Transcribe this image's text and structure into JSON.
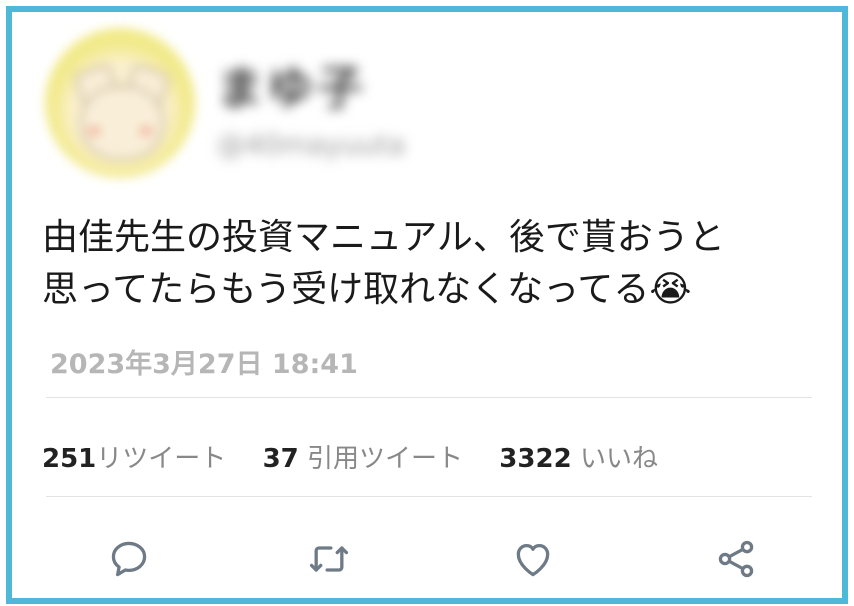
{
  "tweet": {
    "name": "まゆ子",
    "handle": "@40mayuuta",
    "text_line1": "由佳先生の投資マニュアル、後で貰おうと",
    "text_line2": "思ってたらもう受け取れなくなってる😭",
    "timestamp": "2023年3月27日 18:41"
  },
  "stats": {
    "retweets_count": "251",
    "retweets_label": "リツイート",
    "quotes_count": "37",
    "quotes_label": "引用ツイート",
    "likes_count": "3322",
    "likes_label": "いいね"
  },
  "actions": [
    {
      "name": "reply",
      "icon": "comment-icon"
    },
    {
      "name": "retweet",
      "icon": "retweet-icon"
    },
    {
      "name": "like",
      "icon": "heart-icon"
    },
    {
      "name": "share",
      "icon": "share-icon"
    }
  ],
  "colors": {
    "frame": "#4fb8d8",
    "icon": "#6e7a86",
    "timestamp": "#b6b6b6"
  }
}
